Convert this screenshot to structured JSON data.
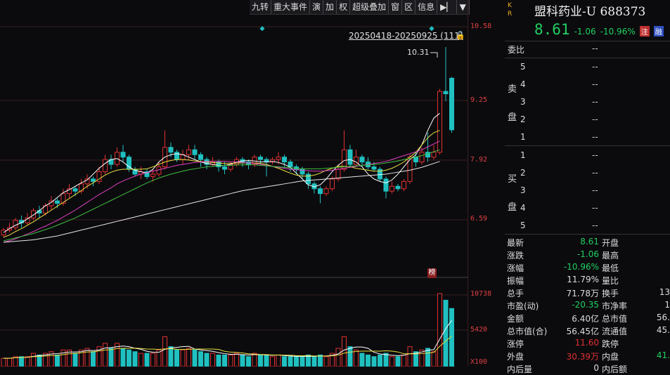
{
  "toolbar": [
    "九转",
    "重大事件",
    "演",
    "加",
    "权",
    "超级叠加",
    "窗",
    "区",
    "信息"
  ],
  "price_axis": [
    "10.58",
    "9.25",
    "7.92",
    "6.59",
    "10738",
    "5420",
    "X100"
  ],
  "range_label": "20250418-20250925 (111)",
  "high_label": "10.31",
  "bang_label": "榜",
  "kr": [
    "K",
    "R"
  ],
  "stock": {
    "name": "盟科药业-U 688373",
    "price": "8.61",
    "change": "-1.06",
    "change_pct": "-10.96%",
    "badges": [
      "注",
      "融"
    ]
  },
  "book": {
    "weibi_label": "委比",
    "weibi_value": "--",
    "sell_label": [
      "卖",
      "盘"
    ],
    "buy_label": [
      "买",
      "盘"
    ],
    "sell": [
      {
        "lvl": "5",
        "p": "--"
      },
      {
        "lvl": "4",
        "p": "--"
      },
      {
        "lvl": "3",
        "p": "--"
      },
      {
        "lvl": "2",
        "p": "--"
      },
      {
        "lvl": "1",
        "p": "--"
      }
    ],
    "buy": [
      {
        "lvl": "1",
        "p": "--"
      },
      {
        "lvl": "2",
        "p": "--"
      },
      {
        "lvl": "3",
        "p": "--"
      },
      {
        "lvl": "4",
        "p": "--"
      },
      {
        "lvl": "5",
        "p": "--"
      }
    ]
  },
  "stats": [
    {
      "l": "最新",
      "v": "8.61",
      "r": "开盘",
      "rv": ""
    },
    {
      "l": "涨跌",
      "v": "-1.06",
      "r": "最高",
      "rv": ""
    },
    {
      "l": "涨幅",
      "v": "-10.96%",
      "r": "最低",
      "rv": ""
    },
    {
      "l": "振幅",
      "v": "11.79%",
      "r": "量比",
      "rv": ""
    },
    {
      "l": "总手",
      "v": "71.78万",
      "r": "换手",
      "rv": "13"
    },
    {
      "l": "市盈(动)",
      "v": "-20.35",
      "r": "市净率",
      "rv": "1"
    },
    {
      "l": "金额",
      "v": "6.40亿",
      "r": "总市值",
      "rv": "56."
    },
    {
      "l": "总市值(合)",
      "v": "56.45亿",
      "r": "流通值",
      "rv": "45."
    },
    {
      "l": "涨停",
      "v": "11.60",
      "r": "跌停",
      "rv": ""
    },
    {
      "l": "外盘",
      "v": "30.39万",
      "r": "内盘",
      "rv": "41."
    },
    {
      "l": "内后量",
      "v": "0",
      "r": "内后额",
      "rv": ""
    }
  ],
  "colors": {
    "up": "#e03030",
    "down": "#20c0c0",
    "ma5": "#ffffff",
    "ma10": "#e8e040",
    "ma20": "#e040c0",
    "ma30": "#40c040",
    "ma60": "#ffffff"
  },
  "chart_data": {
    "type": "candlestick",
    "ylim": [
      6.3,
      10.7
    ],
    "vol_max": 10738,
    "candles": [
      [
        6.45,
        6.55,
        6.4,
        6.6,
        0.25
      ],
      [
        6.55,
        6.6,
        6.5,
        6.7,
        0.25
      ],
      [
        6.6,
        6.75,
        6.55,
        6.8,
        0.3
      ],
      [
        6.75,
        6.7,
        6.6,
        6.85,
        0.3
      ],
      [
        6.7,
        6.8,
        6.65,
        6.9,
        0.3
      ],
      [
        6.8,
        6.95,
        6.75,
        7.0,
        0.4
      ],
      [
        6.95,
        6.9,
        6.8,
        7.05,
        0.35
      ],
      [
        6.9,
        7.05,
        6.85,
        7.1,
        0.4
      ],
      [
        7.05,
        7.15,
        6.95,
        7.25,
        0.45
      ],
      [
        7.15,
        7.1,
        7.0,
        7.2,
        0.35
      ],
      [
        7.1,
        7.3,
        7.05,
        7.4,
        0.5
      ],
      [
        7.3,
        7.4,
        7.2,
        7.5,
        0.5
      ],
      [
        7.4,
        7.35,
        7.25,
        7.45,
        0.4
      ],
      [
        7.35,
        7.5,
        7.3,
        7.6,
        0.5
      ],
      [
        7.5,
        7.6,
        7.4,
        7.7,
        0.55
      ],
      [
        7.6,
        7.55,
        7.45,
        7.65,
        0.45
      ],
      [
        7.55,
        7.75,
        7.5,
        7.85,
        0.6
      ],
      [
        7.75,
        8.0,
        7.7,
        8.1,
        0.7
      ],
      [
        8.0,
        7.9,
        7.8,
        8.1,
        0.55
      ],
      [
        7.9,
        8.15,
        7.85,
        8.25,
        0.7
      ],
      [
        8.15,
        8.05,
        7.95,
        8.3,
        0.55
      ],
      [
        8.05,
        7.8,
        7.75,
        8.1,
        0.5
      ],
      [
        7.8,
        7.7,
        7.65,
        7.85,
        0.45
      ],
      [
        7.7,
        7.75,
        7.6,
        7.85,
        0.4
      ],
      [
        7.75,
        7.65,
        7.6,
        7.8,
        0.4
      ],
      [
        7.65,
        7.7,
        7.55,
        7.8,
        0.4
      ],
      [
        7.7,
        7.85,
        7.65,
        7.95,
        0.5
      ],
      [
        7.85,
        8.25,
        7.8,
        8.6,
        0.9
      ],
      [
        8.25,
        8.15,
        8.05,
        8.35,
        0.6
      ],
      [
        8.15,
        8.0,
        7.95,
        8.2,
        0.5
      ],
      [
        8.0,
        8.1,
        7.9,
        8.2,
        0.5
      ],
      [
        8.1,
        8.2,
        8.0,
        8.3,
        0.55
      ],
      [
        8.2,
        8.1,
        8.0,
        8.3,
        0.5
      ],
      [
        8.1,
        8.0,
        7.85,
        8.15,
        0.45
      ],
      [
        8.0,
        7.9,
        7.8,
        8.05,
        0.4
      ],
      [
        7.9,
        7.95,
        7.85,
        8.05,
        0.4
      ],
      [
        7.95,
        7.85,
        7.75,
        8.0,
        0.35
      ],
      [
        7.85,
        7.8,
        7.7,
        7.95,
        0.35
      ],
      [
        7.8,
        7.9,
        7.75,
        7.95,
        0.35
      ],
      [
        7.9,
        8.0,
        7.85,
        8.05,
        0.4
      ],
      [
        8.0,
        7.95,
        7.85,
        8.05,
        0.35
      ],
      [
        7.95,
        7.9,
        7.8,
        8.0,
        0.3
      ],
      [
        7.9,
        8.05,
        7.85,
        8.1,
        0.4
      ],
      [
        8.05,
        8.0,
        7.9,
        8.1,
        0.35
      ],
      [
        8.0,
        7.95,
        7.65,
        8.05,
        0.35
      ],
      [
        7.95,
        8.0,
        7.9,
        8.05,
        0.3
      ],
      [
        8.0,
        8.05,
        7.9,
        8.15,
        0.35
      ],
      [
        8.05,
        7.95,
        7.85,
        8.1,
        0.3
      ],
      [
        7.95,
        7.85,
        7.75,
        8.0,
        0.3
      ],
      [
        7.85,
        7.8,
        7.7,
        7.9,
        0.3
      ],
      [
        7.8,
        7.7,
        7.6,
        7.85,
        0.3
      ],
      [
        7.7,
        7.5,
        7.4,
        7.75,
        0.35
      ],
      [
        7.5,
        7.4,
        7.3,
        7.55,
        0.3
      ],
      [
        7.4,
        7.3,
        7.1,
        7.45,
        0.35
      ],
      [
        7.3,
        7.4,
        7.25,
        7.45,
        0.3
      ],
      [
        7.4,
        7.6,
        7.35,
        7.65,
        0.4
      ],
      [
        7.6,
        7.8,
        7.55,
        7.9,
        0.55
      ],
      [
        7.8,
        8.2,
        7.75,
        8.6,
        0.9
      ],
      [
        8.2,
        7.9,
        7.85,
        8.3,
        0.6
      ],
      [
        7.9,
        8.05,
        7.85,
        8.2,
        0.5
      ],
      [
        8.05,
        7.95,
        7.85,
        8.1,
        0.4
      ],
      [
        7.95,
        7.85,
        7.8,
        8.05,
        0.35
      ],
      [
        7.85,
        7.8,
        7.75,
        7.95,
        0.3
      ],
      [
        7.8,
        7.6,
        7.55,
        7.85,
        0.35
      ],
      [
        7.6,
        7.35,
        7.2,
        7.65,
        0.4
      ],
      [
        7.35,
        7.45,
        7.3,
        7.55,
        0.3
      ],
      [
        7.45,
        7.4,
        7.35,
        7.5,
        0.3
      ],
      [
        7.4,
        7.55,
        7.35,
        7.6,
        0.35
      ],
      [
        7.55,
        8.05,
        7.5,
        8.1,
        0.6
      ],
      [
        8.05,
        7.95,
        7.85,
        8.15,
        0.45
      ],
      [
        7.95,
        8.15,
        7.9,
        8.25,
        0.5
      ],
      [
        8.15,
        8.05,
        7.95,
        8.55,
        0.55
      ],
      [
        8.05,
        8.15,
        8.0,
        8.3,
        0.45
      ],
      [
        8.15,
        9.4,
        8.1,
        9.45,
        2.2
      ],
      [
        9.4,
        9.35,
        9.2,
        10.31,
        2.0
      ],
      [
        9.67,
        8.61,
        8.55,
        9.7,
        1.75
      ]
    ],
    "ma": {
      "ma5": [
        6.5,
        6.58,
        6.65,
        6.7,
        6.78,
        6.86,
        6.95,
        7.05,
        7.12,
        7.22,
        7.32,
        7.38,
        7.45,
        7.52,
        7.58,
        7.7,
        7.82,
        7.92,
        8.0,
        8.02,
        7.95,
        7.85,
        7.78,
        7.75,
        7.72,
        7.8,
        7.95,
        8.05,
        8.1,
        8.12,
        8.1,
        8.05,
        8.0,
        7.95,
        7.92,
        7.9,
        7.88,
        7.88,
        7.9,
        7.95,
        7.97,
        7.98,
        7.97,
        7.95,
        7.95,
        7.96,
        7.94,
        7.9,
        7.84,
        7.72,
        7.6,
        7.48,
        7.44,
        7.48,
        7.6,
        7.75,
        7.88,
        7.98,
        8.0,
        7.95,
        7.85,
        7.7,
        7.6,
        7.55,
        7.52,
        7.58,
        7.7,
        7.85,
        8.0,
        8.1,
        8.3,
        8.6,
        8.85,
        8.95
      ],
      "ma10": [
        6.4,
        6.45,
        6.52,
        6.58,
        6.65,
        6.72,
        6.8,
        6.88,
        6.96,
        7.04,
        7.12,
        7.2,
        7.28,
        7.36,
        7.45,
        7.52,
        7.6,
        7.68,
        7.74,
        7.78,
        7.8,
        7.8,
        7.8,
        7.8,
        7.81,
        7.85,
        7.9,
        7.95,
        7.98,
        8.0,
        8.0,
        7.99,
        7.97,
        7.96,
        7.95,
        7.94,
        7.93,
        7.92,
        7.92,
        7.93,
        7.93,
        7.93,
        7.93,
        7.92,
        7.9,
        7.86,
        7.82,
        7.77,
        7.72,
        7.68,
        7.66,
        7.66,
        7.68,
        7.72,
        7.78,
        7.82,
        7.86,
        7.86,
        7.85,
        7.82,
        7.8,
        7.78,
        7.76,
        7.76,
        7.78,
        7.82,
        7.88,
        7.95,
        8.05,
        8.15,
        8.3,
        8.45,
        8.55,
        8.6
      ],
      "ma20": [
        6.3,
        6.33,
        6.37,
        6.42,
        6.47,
        6.52,
        6.58,
        6.63,
        6.69,
        6.75,
        6.82,
        6.89,
        6.96,
        7.04,
        7.12,
        7.2,
        7.28,
        7.35,
        7.42,
        7.5,
        7.56,
        7.61,
        7.66,
        7.7,
        7.73,
        7.76,
        7.79,
        7.82,
        7.85,
        7.88,
        7.9,
        7.92,
        7.94,
        7.95,
        7.96,
        7.96,
        7.96,
        7.96,
        7.95,
        7.95,
        7.94,
        7.93,
        7.92,
        7.9,
        7.88,
        7.86,
        7.84,
        7.82,
        7.8,
        7.79,
        7.78,
        7.77,
        7.76,
        7.76,
        7.77,
        7.78,
        7.8,
        7.82,
        7.84,
        7.86,
        7.88,
        7.9,
        7.92,
        7.94,
        7.96,
        8.0,
        8.04,
        8.08,
        8.12,
        8.16,
        8.2,
        8.26,
        8.32,
        8.38
      ],
      "ma30": [
        6.33,
        6.36,
        6.39,
        6.42,
        6.45,
        6.48,
        6.52,
        6.56,
        6.6,
        6.65,
        6.7,
        6.75,
        6.8,
        6.86,
        6.92,
        6.98,
        7.04,
        7.1,
        7.16,
        7.22,
        7.28,
        7.34,
        7.4,
        7.46,
        7.52,
        7.57,
        7.62,
        7.66,
        7.7,
        7.73,
        7.76,
        7.79,
        7.81,
        7.83,
        7.85,
        7.86,
        7.87,
        7.88,
        7.88,
        7.89,
        7.89,
        7.89,
        7.89,
        7.88,
        7.87,
        7.86,
        7.85,
        7.84,
        7.83,
        7.82,
        7.81,
        7.81,
        7.81,
        7.81,
        7.82,
        7.83,
        7.84,
        7.85,
        7.86,
        7.87,
        7.88,
        7.89,
        7.9,
        7.91,
        7.93,
        7.95,
        7.97,
        8.0,
        8.02,
        8.05,
        8.08,
        8.12,
        8.16,
        8.2
      ],
      "ma60": [
        6.3,
        6.31,
        6.32,
        6.33,
        6.34,
        6.35,
        6.37,
        6.39,
        6.41,
        6.43,
        6.46,
        6.49,
        6.52,
        6.55,
        6.58,
        6.61,
        6.64,
        6.67,
        6.7,
        6.73,
        6.76,
        6.79,
        6.82,
        6.85,
        6.88,
        6.91,
        6.94,
        6.97,
        7.0,
        7.03,
        7.06,
        7.09,
        7.12,
        7.15,
        7.18,
        7.21,
        7.24,
        7.27,
        7.3,
        7.33,
        7.36,
        7.38,
        7.4,
        7.42,
        7.44,
        7.46,
        7.48,
        7.5,
        7.52,
        7.54,
        7.56,
        7.57,
        7.58,
        7.59,
        7.6,
        7.61,
        7.62,
        7.63,
        7.64,
        7.65,
        7.66,
        7.67,
        7.68,
        7.69,
        7.7,
        7.72,
        7.74,
        7.76,
        7.78,
        7.81,
        7.84,
        7.88,
        7.92,
        7.96
      ]
    }
  }
}
